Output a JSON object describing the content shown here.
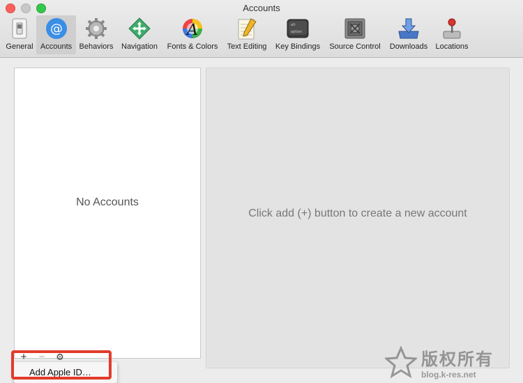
{
  "window": {
    "title": "Accounts"
  },
  "toolbar": {
    "items": [
      {
        "label": "General",
        "icon": "switch-icon",
        "active": false
      },
      {
        "label": "Accounts",
        "icon": "at-sign-icon",
        "active": true
      },
      {
        "label": "Behaviors",
        "icon": "gear-icon",
        "active": false
      },
      {
        "label": "Navigation",
        "icon": "navigation-arrows-icon",
        "active": false
      },
      {
        "label": "Fonts & Colors",
        "icon": "font-color-wheel-icon",
        "active": false
      },
      {
        "label": "Text Editing",
        "icon": "pencil-notepad-icon",
        "active": false
      },
      {
        "label": "Key Bindings",
        "icon": "keyboard-key-icon",
        "active": false
      },
      {
        "label": "Source Control",
        "icon": "vault-icon",
        "active": false
      },
      {
        "label": "Downloads",
        "icon": "download-tray-icon",
        "active": false
      },
      {
        "label": "Locations",
        "icon": "joystick-icon",
        "active": false
      }
    ]
  },
  "accounts_list": {
    "empty_text": "No Accounts"
  },
  "detail": {
    "empty_text": "Click add (+) button to create a new account"
  },
  "bottom_bar": {
    "add": "+",
    "remove": "−",
    "settings": "⚙"
  },
  "add_menu": {
    "items": [
      "Add Apple ID…"
    ]
  },
  "watermark": {
    "text_cn": "版权所有",
    "url": "blog.k-res.net"
  },
  "colors": {
    "accent": "#3a8ee6",
    "highlight": "#e23b2b"
  }
}
